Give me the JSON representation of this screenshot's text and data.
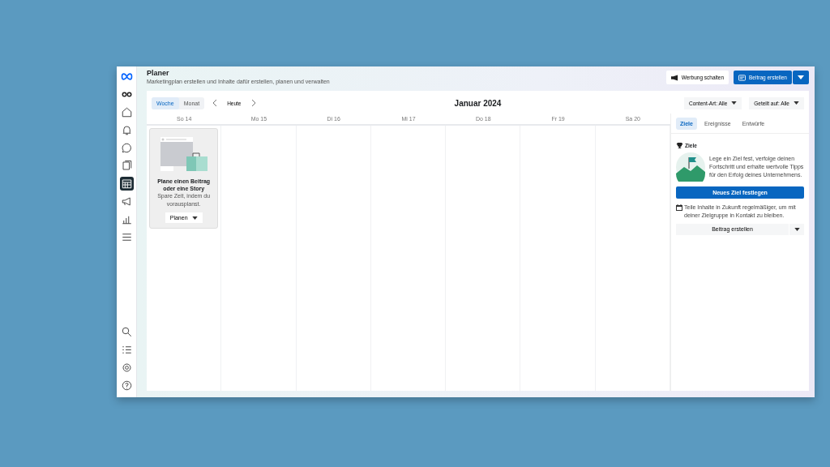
{
  "header": {
    "title": "Planer",
    "subtitle": "Marketingplan erstellen und Inhalte dafür erstellen, planen und verwalten",
    "ad_button": "Werbung schalten",
    "create_button": "Beitrag erstellen"
  },
  "nav": {
    "top": [
      {
        "kind": "meta",
        "selected": false
      },
      {
        "kind": "glasses",
        "selected": false
      },
      {
        "kind": "home",
        "selected": false
      },
      {
        "kind": "bell",
        "selected": false
      },
      {
        "kind": "chat",
        "selected": false
      },
      {
        "kind": "stack",
        "selected": false
      },
      {
        "kind": "calendar",
        "selected": true
      },
      {
        "kind": "megaphone",
        "selected": false
      },
      {
        "kind": "chart",
        "selected": false
      },
      {
        "kind": "menu",
        "selected": false
      }
    ],
    "bottom": [
      {
        "kind": "search",
        "selected": false
      },
      {
        "kind": "list",
        "selected": false
      },
      {
        "kind": "settings",
        "selected": false
      },
      {
        "kind": "help",
        "selected": false
      }
    ]
  },
  "toolbar": {
    "views": [
      {
        "label": "Woche",
        "selected": true
      },
      {
        "label": "Monat",
        "selected": false
      }
    ],
    "today": "Heute",
    "month": "Januar 2024",
    "filters": [
      "Content-Art: Alle",
      "Geteilt auf: Alle"
    ]
  },
  "days": [
    "So 14",
    "Mo 15",
    "Di 16",
    "Mi 17",
    "Do 18",
    "Fr 19",
    "Sa 20"
  ],
  "plan_card": {
    "title": "Plane einen Beitrag oder eine Story",
    "text": "Spare Zeit, indem du vorausplanst.",
    "button": "Planen"
  },
  "panel": {
    "tabs": [
      {
        "label": "Ziele",
        "selected": true
      },
      {
        "label": "Ereignisse",
        "selected": false
      },
      {
        "label": "Entwürfe",
        "selected": false
      }
    ],
    "heading": "Ziele",
    "goal_text": "Lege ein Ziel fest, verfolge deinen Fortschritt und erhalte wertvolle Tipps für den Erfolg deines Unternehmens.",
    "goal_button": "Neues Ziel festlegen",
    "share_text": "Teile Inhalte in Zukunft regelmäßiger, um mit deiner Zielgruppe in Kontakt zu bleiben.",
    "share_button": "Beitrag erstellen"
  }
}
